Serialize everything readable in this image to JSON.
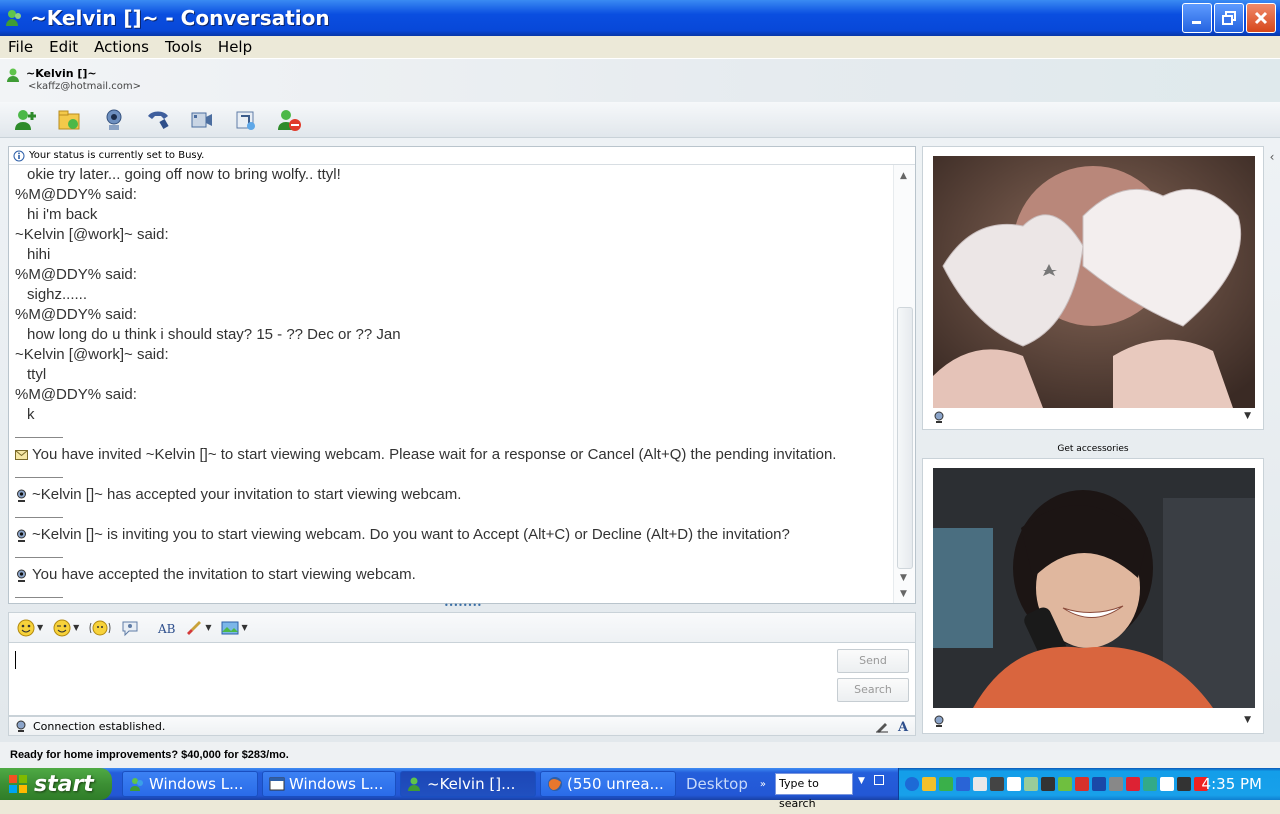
{
  "window": {
    "title": "~Kelvin []~ - Conversation",
    "controls": [
      "minimize",
      "maximize",
      "close"
    ]
  },
  "menu": {
    "items": [
      "File",
      "Edit",
      "Actions",
      "Tools",
      "Help"
    ]
  },
  "contact": {
    "name": "~Kelvin []~",
    "email": "<kaffz@hotmail.com>"
  },
  "toolbar": {
    "icons": [
      "invite-contact-icon",
      "send-files-icon",
      "webcam-icon",
      "call-icon",
      "video-call-icon",
      "activities-icon",
      "block-icon"
    ]
  },
  "status": {
    "text": "Your status is currently set to Busy."
  },
  "history": {
    "lines": [
      {
        "type": "msg",
        "text": "okie try later... going off now to bring wolfy.. ttyl!"
      },
      {
        "type": "said",
        "text": "%M@DDY% said:"
      },
      {
        "type": "msg",
        "text": "hi i'm back"
      },
      {
        "type": "said",
        "text": "~Kelvin [@work]~ said:"
      },
      {
        "type": "msg",
        "text": "hihi"
      },
      {
        "type": "said",
        "text": "%M@DDY% said:"
      },
      {
        "type": "msg",
        "text": "sighz......"
      },
      {
        "type": "said",
        "text": "%M@DDY% said:"
      },
      {
        "type": "msg",
        "text": "how long do u think i should stay? 15 - ?? Dec or ?? Jan"
      },
      {
        "type": "said",
        "text": "~Kelvin [@work]~ said:"
      },
      {
        "type": "msg",
        "text": "ttyl"
      },
      {
        "type": "said",
        "text": "%M@DDY% said:"
      },
      {
        "type": "msg",
        "text": "k"
      }
    ],
    "system": [
      {
        "icon": "envelope-icon",
        "text": "You have invited ~Kelvin []~ to start viewing webcam. Please wait for a response or Cancel (Alt+Q) the pending invitation."
      },
      {
        "icon": "webcam-small-icon",
        "text": "~Kelvin []~ has accepted your invitation to start viewing webcam."
      },
      {
        "icon": "webcam-small-icon",
        "text": "~Kelvin []~ is inviting you to start viewing webcam. Do you want to Accept (Alt+C) or Decline (Alt+D) the invitation?"
      },
      {
        "icon": "webcam-small-icon",
        "text": "You have accepted the invitation to start viewing webcam."
      }
    ]
  },
  "compose": {
    "send_label": "Send",
    "search_label": "Search"
  },
  "connection": {
    "text": "Connection established."
  },
  "webcam": {
    "accessories_label": "Get accessories"
  },
  "ad": {
    "text": "Ready for home improvements? $40,000 for $283/mo."
  },
  "taskbar": {
    "start_label": "start",
    "tasks": [
      {
        "label": "Windows L..."
      },
      {
        "label": "Windows L..."
      },
      {
        "label": "~Kelvin []..."
      },
      {
        "label": "(550 unrea..."
      }
    ],
    "desktop_label": "Desktop",
    "search_placeholder": "Type to search",
    "clock": "4:35 PM"
  },
  "colors": {
    "titlebar": "#0a4ee0",
    "taskbar": "#245edb",
    "start": "#3c8f34",
    "tray": "#139ee9"
  }
}
